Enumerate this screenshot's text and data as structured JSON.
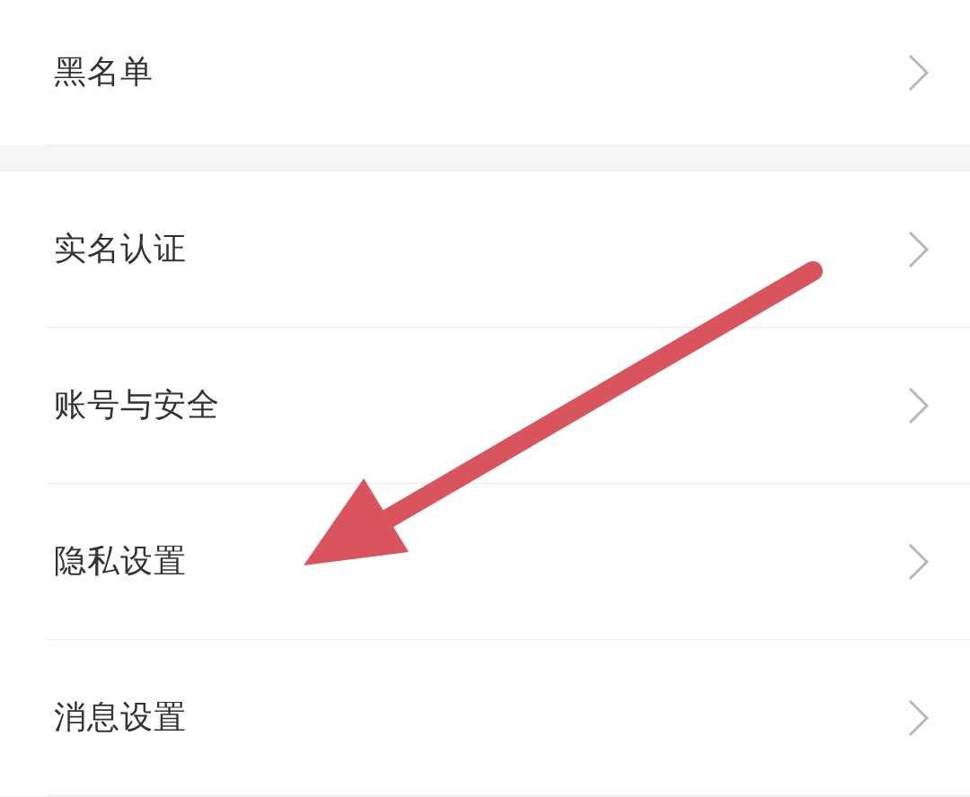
{
  "sections": [
    {
      "items": [
        {
          "label": "黑名单"
        }
      ]
    },
    {
      "items": [
        {
          "label": "实名认证"
        },
        {
          "label": "账号与安全"
        },
        {
          "label": "隐私设置"
        },
        {
          "label": "消息设置"
        }
      ]
    }
  ]
}
